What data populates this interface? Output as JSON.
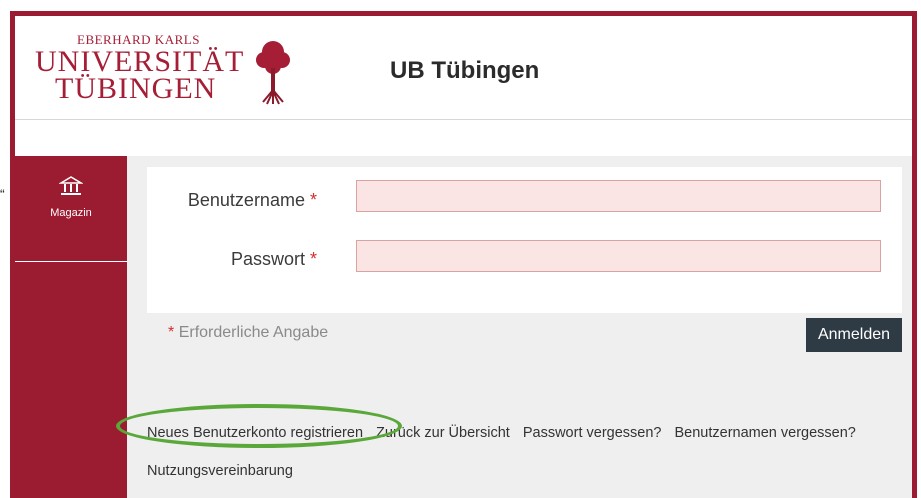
{
  "header": {
    "logo_line1": "EBERHARD KARLS",
    "logo_line2": "UNIVERSITÄT",
    "logo_line3": "TÜBINGEN",
    "title": "UB Tübingen"
  },
  "sidebar": {
    "items": [
      {
        "label": "Magazin",
        "icon": "library-icon"
      }
    ]
  },
  "form": {
    "username_label": "Benutzername",
    "password_label": "Passwort",
    "required_star": "*",
    "username_value": "",
    "password_value": "",
    "required_note": "Erforderliche Angabe",
    "login_label": "Anmelden"
  },
  "links": {
    "register": "Neues Benutzerkonto registrieren",
    "back": "Zurück zur Übersicht",
    "forgot_password": "Passwort vergessen?",
    "forgot_username": "Benutzernamen vergessen?",
    "terms": "Nutzungsvereinbarung"
  },
  "annotation": {
    "highlight_color": "#5aa83a"
  },
  "colors": {
    "brand": "#9b1b30",
    "button": "#2f3b44",
    "input_bg": "#fbe4e4"
  }
}
